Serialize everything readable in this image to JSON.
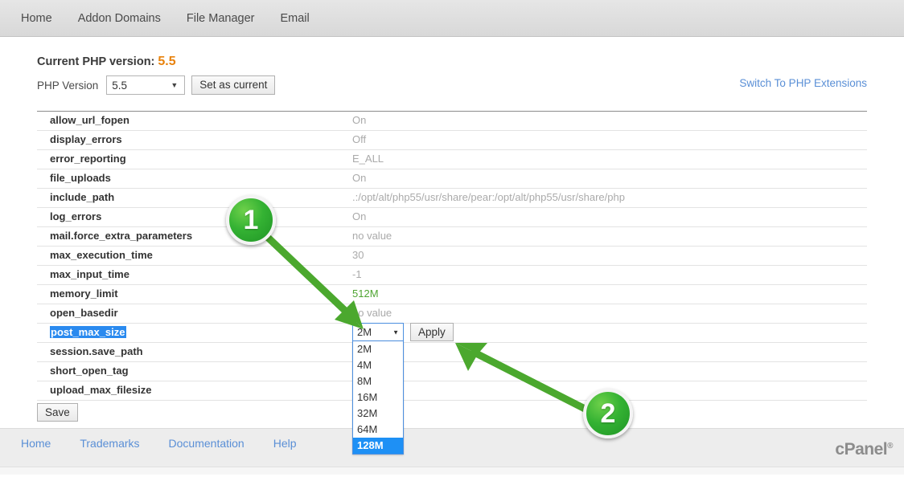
{
  "topnav": {
    "items": [
      {
        "label": "Home"
      },
      {
        "label": "Addon Domains"
      },
      {
        "label": "File Manager"
      },
      {
        "label": "Email"
      }
    ]
  },
  "header": {
    "current_version_label": "Current PHP version:",
    "current_version_value": "5.5",
    "php_version_label": "PHP Version",
    "php_version_selected": "5.5",
    "set_as_current_label": "Set as current",
    "switch_extensions_label": "Switch To PHP Extensions",
    "caret_glyph": "▼"
  },
  "settings": {
    "rows": [
      {
        "name": "allow_url_fopen",
        "value": "On"
      },
      {
        "name": "display_errors",
        "value": "Off"
      },
      {
        "name": "error_reporting",
        "value": "E_ALL"
      },
      {
        "name": "file_uploads",
        "value": "On"
      },
      {
        "name": "include_path",
        "value": ".:/opt/alt/php55/usr/share/pear:/opt/alt/php55/usr/share/php"
      },
      {
        "name": "log_errors",
        "value": "On"
      },
      {
        "name": "mail.force_extra_parameters",
        "value": "no value"
      },
      {
        "name": "max_execution_time",
        "value": "30"
      },
      {
        "name": "max_input_time",
        "value": "-1"
      },
      {
        "name": "memory_limit",
        "value": "512M"
      },
      {
        "name": "open_basedir",
        "value": "no value"
      },
      {
        "name": "post_max_size",
        "value": ""
      },
      {
        "name": "session.save_path",
        "value": ""
      },
      {
        "name": "short_open_tag",
        "value": ""
      },
      {
        "name": "upload_max_filesize",
        "value": ""
      }
    ],
    "editor": {
      "selected_value": "2M",
      "caret_glyph": "▼",
      "apply_label": "Apply",
      "options": [
        "2M",
        "4M",
        "8M",
        "16M",
        "32M",
        "64M",
        "128M"
      ],
      "highlighted_option": "128M"
    },
    "save_label": "Save"
  },
  "footer": {
    "links": [
      {
        "label": "Home"
      },
      {
        "label": "Trademarks"
      },
      {
        "label": "Documentation"
      },
      {
        "label": "Help"
      }
    ],
    "brand": "cPanel",
    "brand_mark": "®"
  },
  "callouts": [
    {
      "number": "1"
    },
    {
      "number": "2"
    }
  ],
  "colors": {
    "accent_orange": "#e8820c",
    "link_blue": "#5a8fd6",
    "select_blue": "#1e90f5",
    "callout_green": "#34b233",
    "value_green": "#4fa532"
  }
}
